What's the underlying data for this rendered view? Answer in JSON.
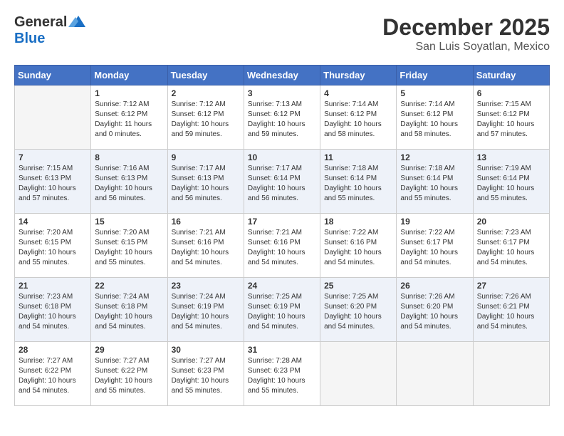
{
  "logo": {
    "general": "General",
    "blue": "Blue"
  },
  "title": "December 2025",
  "location": "San Luis Soyatlan, Mexico",
  "days_of_week": [
    "Sunday",
    "Monday",
    "Tuesday",
    "Wednesday",
    "Thursday",
    "Friday",
    "Saturday"
  ],
  "weeks": [
    [
      {
        "day": "",
        "empty": true,
        "content": ""
      },
      {
        "day": "1",
        "content": "Sunrise: 7:12 AM\nSunset: 6:12 PM\nDaylight: 11 hours\nand 0 minutes."
      },
      {
        "day": "2",
        "content": "Sunrise: 7:12 AM\nSunset: 6:12 PM\nDaylight: 10 hours\nand 59 minutes."
      },
      {
        "day": "3",
        "content": "Sunrise: 7:13 AM\nSunset: 6:12 PM\nDaylight: 10 hours\nand 59 minutes."
      },
      {
        "day": "4",
        "content": "Sunrise: 7:14 AM\nSunset: 6:12 PM\nDaylight: 10 hours\nand 58 minutes."
      },
      {
        "day": "5",
        "content": "Sunrise: 7:14 AM\nSunset: 6:12 PM\nDaylight: 10 hours\nand 58 minutes."
      },
      {
        "day": "6",
        "content": "Sunrise: 7:15 AM\nSunset: 6:12 PM\nDaylight: 10 hours\nand 57 minutes."
      }
    ],
    [
      {
        "day": "7",
        "content": "Sunrise: 7:15 AM\nSunset: 6:13 PM\nDaylight: 10 hours\nand 57 minutes."
      },
      {
        "day": "8",
        "content": "Sunrise: 7:16 AM\nSunset: 6:13 PM\nDaylight: 10 hours\nand 56 minutes."
      },
      {
        "day": "9",
        "content": "Sunrise: 7:17 AM\nSunset: 6:13 PM\nDaylight: 10 hours\nand 56 minutes."
      },
      {
        "day": "10",
        "content": "Sunrise: 7:17 AM\nSunset: 6:14 PM\nDaylight: 10 hours\nand 56 minutes."
      },
      {
        "day": "11",
        "content": "Sunrise: 7:18 AM\nSunset: 6:14 PM\nDaylight: 10 hours\nand 55 minutes."
      },
      {
        "day": "12",
        "content": "Sunrise: 7:18 AM\nSunset: 6:14 PM\nDaylight: 10 hours\nand 55 minutes."
      },
      {
        "day": "13",
        "content": "Sunrise: 7:19 AM\nSunset: 6:14 PM\nDaylight: 10 hours\nand 55 minutes."
      }
    ],
    [
      {
        "day": "14",
        "content": "Sunrise: 7:20 AM\nSunset: 6:15 PM\nDaylight: 10 hours\nand 55 minutes."
      },
      {
        "day": "15",
        "content": "Sunrise: 7:20 AM\nSunset: 6:15 PM\nDaylight: 10 hours\nand 55 minutes."
      },
      {
        "day": "16",
        "content": "Sunrise: 7:21 AM\nSunset: 6:16 PM\nDaylight: 10 hours\nand 54 minutes."
      },
      {
        "day": "17",
        "content": "Sunrise: 7:21 AM\nSunset: 6:16 PM\nDaylight: 10 hours\nand 54 minutes."
      },
      {
        "day": "18",
        "content": "Sunrise: 7:22 AM\nSunset: 6:16 PM\nDaylight: 10 hours\nand 54 minutes."
      },
      {
        "day": "19",
        "content": "Sunrise: 7:22 AM\nSunset: 6:17 PM\nDaylight: 10 hours\nand 54 minutes."
      },
      {
        "day": "20",
        "content": "Sunrise: 7:23 AM\nSunset: 6:17 PM\nDaylight: 10 hours\nand 54 minutes."
      }
    ],
    [
      {
        "day": "21",
        "content": "Sunrise: 7:23 AM\nSunset: 6:18 PM\nDaylight: 10 hours\nand 54 minutes."
      },
      {
        "day": "22",
        "content": "Sunrise: 7:24 AM\nSunset: 6:18 PM\nDaylight: 10 hours\nand 54 minutes."
      },
      {
        "day": "23",
        "content": "Sunrise: 7:24 AM\nSunset: 6:19 PM\nDaylight: 10 hours\nand 54 minutes."
      },
      {
        "day": "24",
        "content": "Sunrise: 7:25 AM\nSunset: 6:19 PM\nDaylight: 10 hours\nand 54 minutes."
      },
      {
        "day": "25",
        "content": "Sunrise: 7:25 AM\nSunset: 6:20 PM\nDaylight: 10 hours\nand 54 minutes."
      },
      {
        "day": "26",
        "content": "Sunrise: 7:26 AM\nSunset: 6:20 PM\nDaylight: 10 hours\nand 54 minutes."
      },
      {
        "day": "27",
        "content": "Sunrise: 7:26 AM\nSunset: 6:21 PM\nDaylight: 10 hours\nand 54 minutes."
      }
    ],
    [
      {
        "day": "28",
        "content": "Sunrise: 7:27 AM\nSunset: 6:22 PM\nDaylight: 10 hours\nand 54 minutes."
      },
      {
        "day": "29",
        "content": "Sunrise: 7:27 AM\nSunset: 6:22 PM\nDaylight: 10 hours\nand 55 minutes."
      },
      {
        "day": "30",
        "content": "Sunrise: 7:27 AM\nSunset: 6:23 PM\nDaylight: 10 hours\nand 55 minutes."
      },
      {
        "day": "31",
        "content": "Sunrise: 7:28 AM\nSunset: 6:23 PM\nDaylight: 10 hours\nand 55 minutes."
      },
      {
        "day": "",
        "empty": true,
        "content": ""
      },
      {
        "day": "",
        "empty": true,
        "content": ""
      },
      {
        "day": "",
        "empty": true,
        "content": ""
      }
    ]
  ]
}
